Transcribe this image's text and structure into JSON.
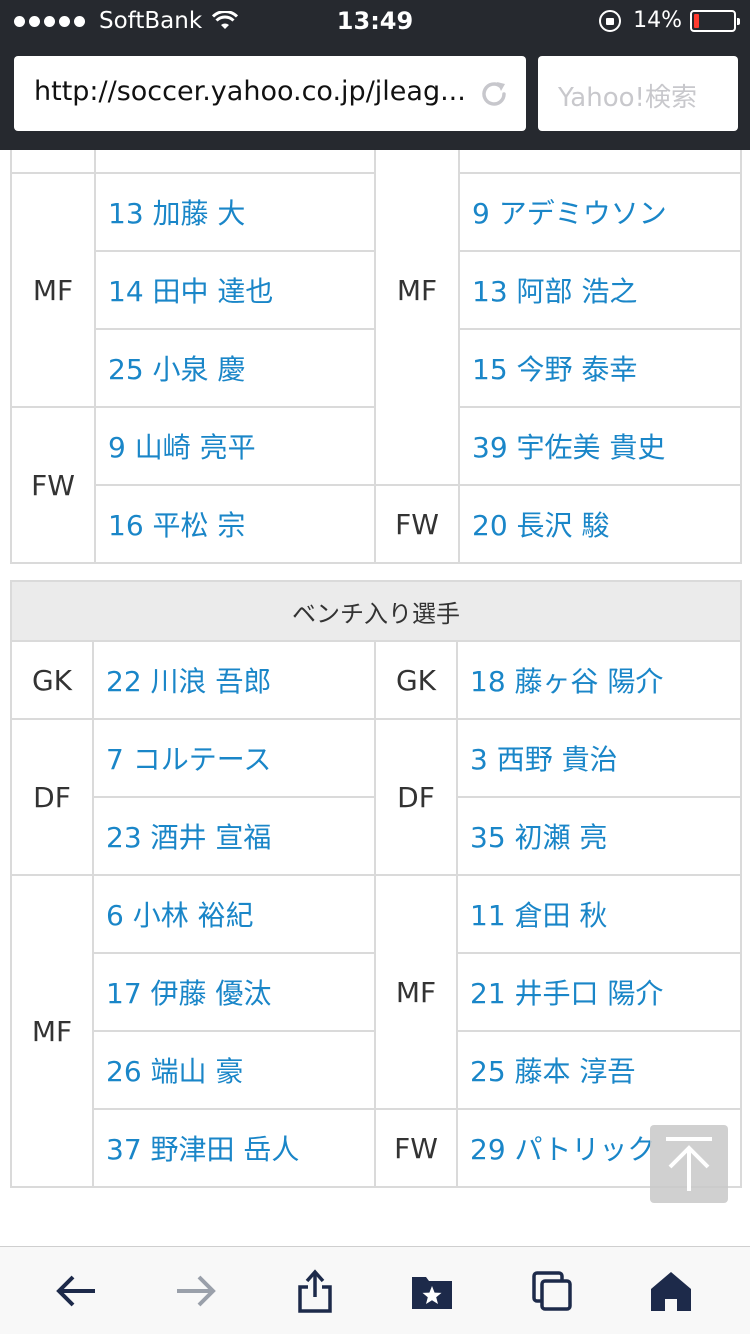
{
  "status_bar": {
    "carrier": "SoftBank",
    "time": "13:49",
    "battery": "14%",
    "battery_level": 0.14,
    "battery_color": "#ff3b30"
  },
  "browser": {
    "url": "http://soccer.yahoo.co.jp/jleag...",
    "search_placeholder": "Yahoo!検索"
  },
  "starting": {
    "rows": [
      {
        "home_pos": "",
        "home_player": "",
        "away_pos": "",
        "away_player": ""
      },
      {
        "home_pos": "MF",
        "home_player": "13 加藤 大",
        "away_pos": "",
        "away_player": "9 アデミウソン"
      },
      {
        "home_pos": "",
        "home_player": "14 田中 達也",
        "away_pos": "MF",
        "away_player": "13 阿部 浩之"
      },
      {
        "home_pos": "",
        "home_player": "25 小泉 慶",
        "away_pos": "",
        "away_player": "15 今野 泰幸"
      },
      {
        "home_pos": "FW",
        "home_player": "9 山崎 亮平",
        "away_pos": "",
        "away_player": "39 宇佐美 貴史"
      },
      {
        "home_pos": "",
        "home_player": "16 平松 宗",
        "away_pos": "FW",
        "away_player": "20 長沢 駿"
      }
    ]
  },
  "bench": {
    "title": "ベンチ入り選手",
    "gk": {
      "home_pos": "GK",
      "home": "22 川浪 吾郎",
      "away_pos": "GK",
      "away": "18 藤ヶ谷 陽介"
    },
    "df": {
      "home_pos": "DF",
      "home": [
        "7 コルテース",
        "23 酒井 宣福"
      ],
      "away_pos": "DF",
      "away": [
        "3 西野 貴治",
        "35 初瀬 亮"
      ]
    },
    "mf": {
      "home_pos": "MF",
      "home": [
        "6 小林 裕紀",
        "17 伊藤 優汰",
        "26 端山 豪",
        "37 野津田 岳人"
      ],
      "away_pos": "MF",
      "away": [
        "11 倉田 秋",
        "21 井手口 陽介",
        "25 藤本 淳吾"
      ]
    },
    "fw": {
      "away_pos": "FW",
      "away": "29 パトリック"
    }
  },
  "icons": {
    "back": "arrow-left-icon",
    "forward": "arrow-right-icon",
    "share": "share-icon",
    "bookmarks": "bookmarks-icon",
    "tabs": "tabs-icon",
    "home": "home-icon",
    "reload": "reload-icon",
    "to_top": "scroll-top-icon"
  },
  "colors": {
    "chrome_bg": "#26292f",
    "link": "#1a86c8",
    "toolbar_icon": "#1d2a4a"
  }
}
